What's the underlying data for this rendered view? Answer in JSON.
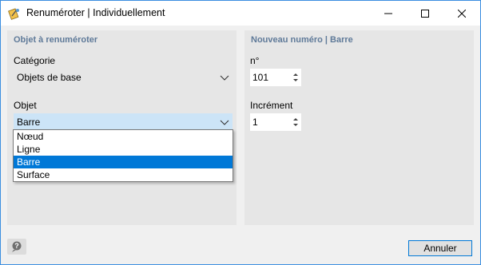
{
  "window": {
    "title": "Renuméroter | Individuellement"
  },
  "left_panel": {
    "title": "Objet à renuméroter",
    "category_label": "Catégorie",
    "category_value": "Objets de base",
    "object_label": "Objet",
    "object_value": "Barre",
    "object_options": [
      "Nœud",
      "Ligne",
      "Barre",
      "Surface"
    ],
    "object_selected": "Barre"
  },
  "right_panel": {
    "title": "Nouveau numéro | Barre",
    "number_label": "n°",
    "number_value": "101",
    "increment_label": "Incrément",
    "increment_value": "1"
  },
  "footer": {
    "cancel_label": "Annuler"
  },
  "colors": {
    "accent": "#0078d7",
    "panel_title": "#5f7a99",
    "panel_bg": "#e6e6e6"
  },
  "icons": [
    "app-renumber-icon",
    "minimize-icon",
    "maximize-icon",
    "close-icon",
    "chevron-down-icon",
    "spin-up-icon",
    "spin-down-icon",
    "help-icon"
  ]
}
